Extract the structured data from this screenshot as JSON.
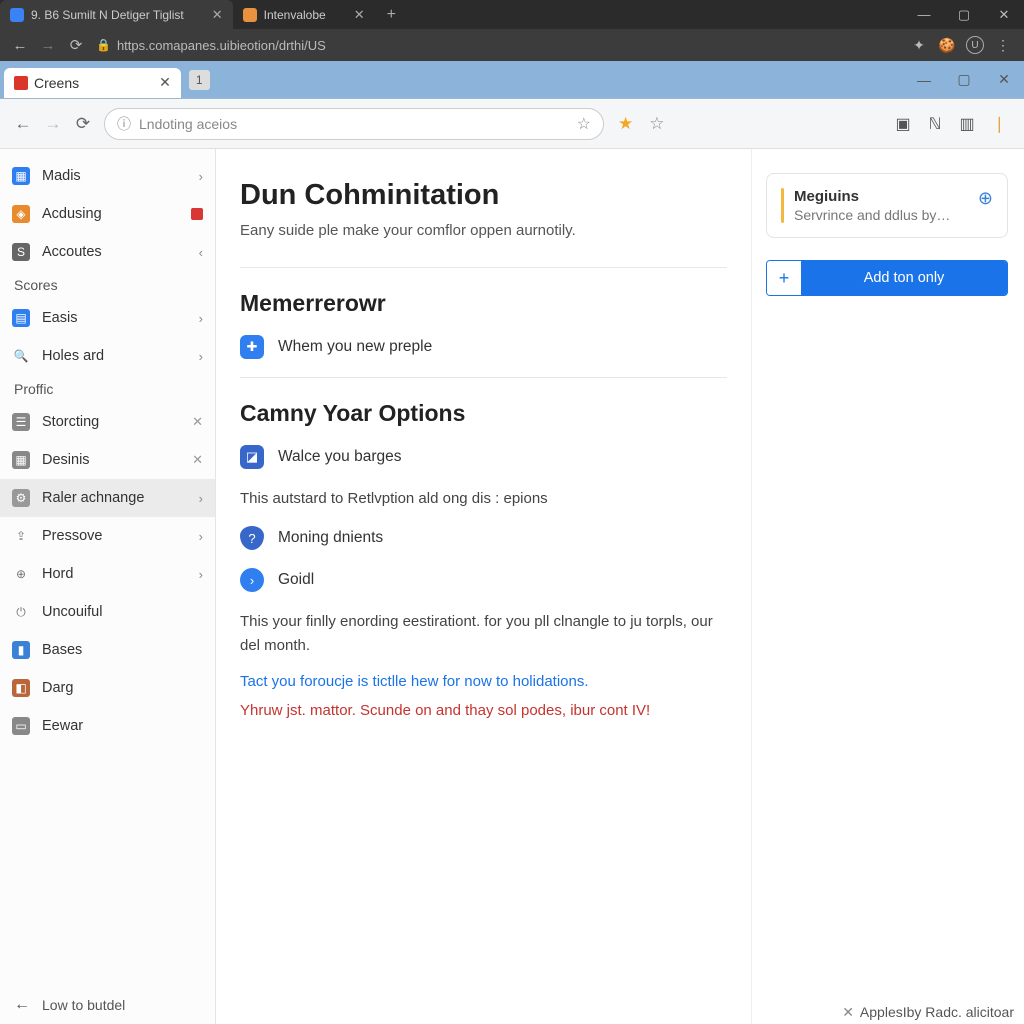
{
  "chrome": {
    "tabs": [
      {
        "label": "9. B6 Sumilt N Detiger Tiglist",
        "active": true
      },
      {
        "label": "Intenvalobe",
        "active": false
      }
    ],
    "url": "https.comapanes.uibieotion/drthi/US"
  },
  "inner": {
    "tab_label": "Creens",
    "tab_count": "1",
    "url_placeholder": "Lndoting aceios"
  },
  "sidebar": {
    "section1": "Scores",
    "section2": "Proffic",
    "items": {
      "madis": "Madis",
      "acdusing": "Acdusing",
      "accoutes": "Accoutes",
      "easis": "Easis",
      "holes": "Holes ard",
      "storcting": "Storcting",
      "desinis": "Desinis",
      "raler": "Raler achnange",
      "pressove": "Pressove",
      "hord": "Hord",
      "uncouiful": "Uncouiful",
      "bases": "Bases",
      "darg": "Darg",
      "eewar": "Eewar"
    },
    "footer": "Low to butdel"
  },
  "article": {
    "h1": "Dun Cohminitation",
    "sub": "Eany suide ple make your comflor oppen aurnotily.",
    "h2a": "Memerrerowr",
    "opt1": "Whem you new preple",
    "h2b": "Camny Yoar Options",
    "opt2": "Walce you barges",
    "para1": "This autstard to Retlvption ald ong dis : epions",
    "opt3": "Moning dnients",
    "opt4": "Goidl",
    "para2": "This your finlly enording eestirationt. for you pll clnangle to ju torpls, our del month.",
    "link1": "Tact you foroucje is tictlle hew for now to holidations.",
    "link2": "Yhruw jst. mattor. Scunde on and thay sol podes, ibur cont IV!"
  },
  "aside": {
    "card_title": "Megiuins",
    "card_sub": "Servrince and ddlus by…",
    "add_btn": "Add ton only"
  },
  "status": "ApplesIby Radc. alicitoar"
}
